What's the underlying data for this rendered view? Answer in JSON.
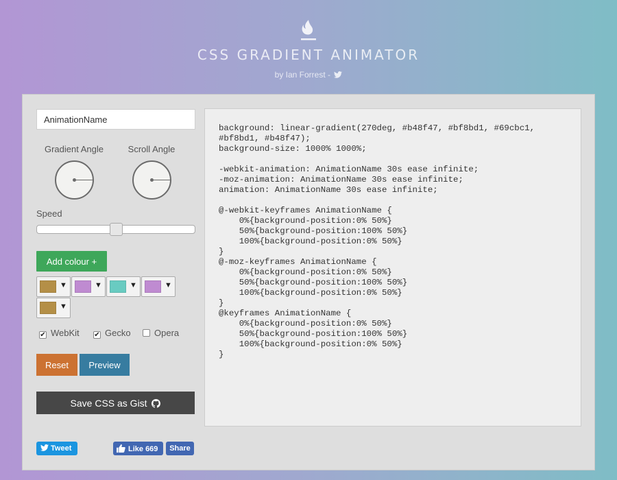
{
  "header": {
    "title": "CSS GRADIENT ANIMATOR",
    "byline": "by Ian Forrest -",
    "logo_icon": "flame-icon",
    "byline_icon": "twitter-bird-icon"
  },
  "editor": {
    "animation_name_value": "AnimationName",
    "gradient_angle_label": "Gradient Angle",
    "scroll_angle_label": "Scroll Angle",
    "speed_label": "Speed",
    "speed_value": 0.5,
    "add_colour_label": "Add colour +",
    "colours": [
      {
        "hex": "#b48f47"
      },
      {
        "hex": "#bf8bd1"
      },
      {
        "hex": "#69cbc1"
      },
      {
        "hex": "#bf8bd1"
      },
      {
        "hex": "#b48f47"
      }
    ],
    "prefixes": [
      {
        "label": "WebKit",
        "checked": true
      },
      {
        "label": "Gecko",
        "checked": true
      },
      {
        "label": "Opera",
        "checked": false
      }
    ],
    "reset_label": "Reset",
    "preview_label": "Preview",
    "gist_label": "Save CSS as Gist"
  },
  "social": {
    "tweet_label": "Tweet",
    "like_label": "Like 669",
    "share_label": "Share"
  },
  "output": {
    "code": "background: linear-gradient(270deg, #b48f47, #bf8bd1, #69cbc1,\n#bf8bd1, #b48f47);\nbackground-size: 1000% 1000%;\n\n-webkit-animation: AnimationName 30s ease infinite;\n-moz-animation: AnimationName 30s ease infinite;\nanimation: AnimationName 30s ease infinite;\n\n@-webkit-keyframes AnimationName {\n    0%{background-position:0% 50%}\n    50%{background-position:100% 50%}\n    100%{background-position:0% 50%}\n}\n@-moz-keyframes AnimationName {\n    0%{background-position:0% 50%}\n    50%{background-position:100% 50%}\n    100%{background-position:0% 50%}\n}\n@keyframes AnimationName {\n    0%{background-position:0% 50%}\n    50%{background-position:100% 50%}\n    100%{background-position:0% 50%}\n}"
  }
}
